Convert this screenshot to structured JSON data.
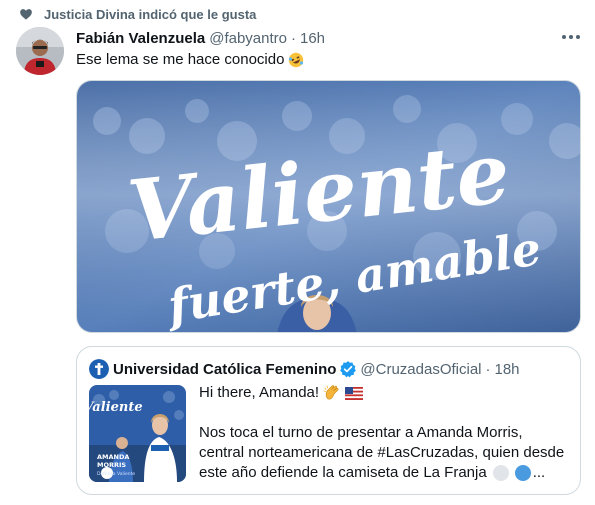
{
  "social_context": {
    "icon": "heart-icon",
    "text": "Justicia Divina indicó que le gusta"
  },
  "tweet": {
    "author_name": "Fabián Valenzuela",
    "author_handle": "@fabyantro",
    "separator": "·",
    "time": "16h",
    "text": "Ese lema se me hace conocido",
    "emoji": "rolling-on-floor-laughing-emoji",
    "more_icon": "more-icon",
    "media": {
      "line1": "Valiente",
      "line2": "fuerte, amable",
      "colors": {
        "primary": "#1e3f7a",
        "light": "#6f8fc0"
      }
    }
  },
  "quote": {
    "author_name": "Universidad Católica Femenino",
    "verified_icon": "verified-badge-icon",
    "author_handle": "@CruzadasOficial",
    "separator": "·",
    "time": "18h",
    "line1": "Hi there, Amanda!",
    "line1_emojis": [
      "clapping-hands-emoji",
      "us-flag-emoji"
    ],
    "line3": "Nos toca el turno de presentar a Amanda Morris,",
    "line4": "central norteamericana de #LasCruzadas, quien desde",
    "line5": "este año defiende la camiseta de La Franja",
    "line5_emojis": [
      "white-circle-emoji",
      "blue-circle-emoji"
    ],
    "ellipsis": "...",
    "thumbnail": {
      "title": "Valiente",
      "name_line1": "AMANDA",
      "name_line2": "MORRIS",
      "position": "Defensa Valiente"
    }
  },
  "colors": {
    "text_primary": "#0f1419",
    "text_secondary": "#536471",
    "verified": "#1d9bf0",
    "border": "#cfd9de"
  }
}
